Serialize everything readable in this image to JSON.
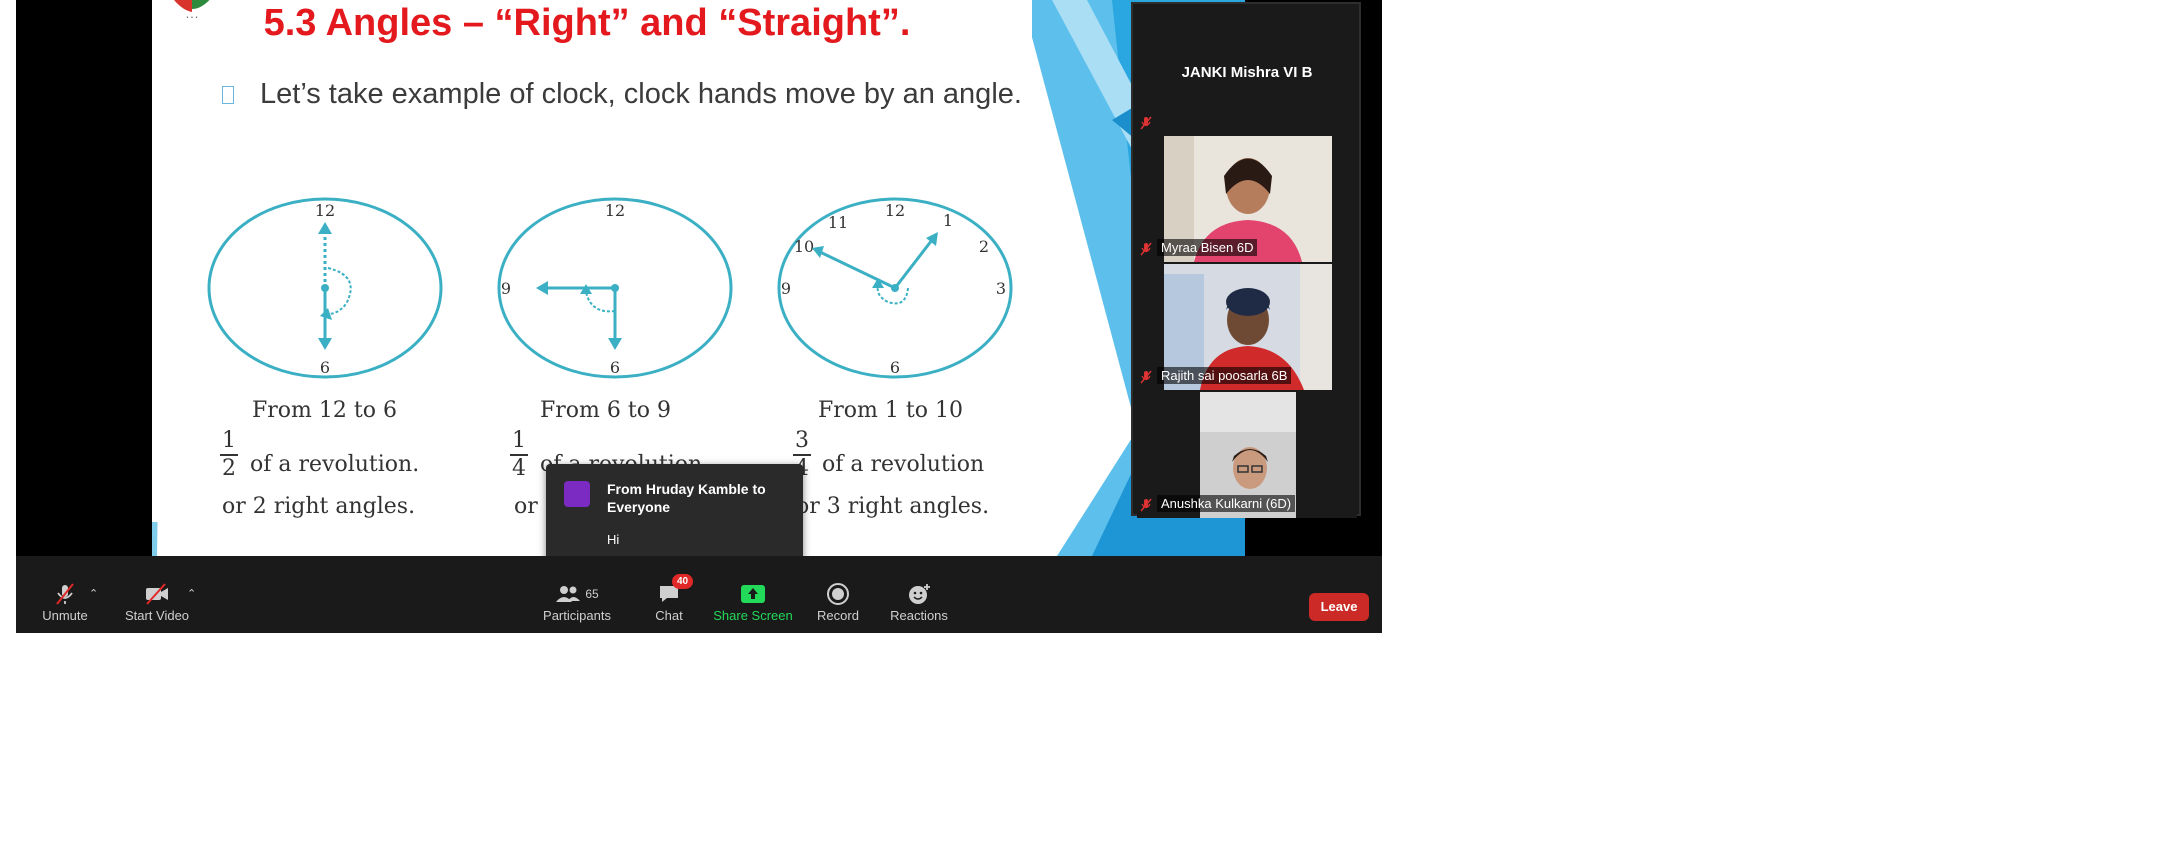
{
  "slide": {
    "title": "5.3 Angles – “Right” and “Straight”.",
    "bullet": "Let’s take example of clock, clock hands move by an angle.",
    "clocks": [
      {
        "caption": "From 12 to 6",
        "numerator": "1",
        "denominator": "2",
        "rev_text": "of a revolution.",
        "line2": "or 2 right angles.",
        "numbers": [
          "12",
          "6"
        ]
      },
      {
        "caption": "From 6 to 9",
        "numerator": "1",
        "denominator": "4",
        "rev_text": "of a revolution",
        "line2": "or",
        "numbers": [
          "12",
          "9",
          "6"
        ]
      },
      {
        "caption": "From 1 to 10",
        "numerator": "3",
        "denominator": "4",
        "rev_text": "of a revolution",
        "line2": "or 3 right angles.",
        "numbers": [
          "12",
          "11",
          "1",
          "10",
          "2",
          "9",
          "3",
          "6"
        ]
      }
    ]
  },
  "gallery": {
    "host_name": "JANKI Mishra VI B",
    "participants": [
      {
        "name": "Myraa Bisen 6D"
      },
      {
        "name": "Rajith sai poosarla 6B"
      },
      {
        "name": "Anushka Kulkarni (6D)"
      }
    ]
  },
  "chat_popup": {
    "from": "From Hruday Kamble to Everyone",
    "message": "Hi"
  },
  "toolbar": {
    "unmute": "Unmute",
    "start_video": "Start Video",
    "participants": "Participants",
    "participants_count": "65",
    "chat": "Chat",
    "chat_badge": "40",
    "share_screen": "Share Screen",
    "record": "Record",
    "reactions": "Reactions",
    "leave": "Leave"
  },
  "colors": {
    "title_red": "#e4191e",
    "clock_blue": "#3bb0c4",
    "share_green": "#23d959",
    "leave_red": "#cb2a26",
    "chat_avatar": "#7b2bc2"
  }
}
